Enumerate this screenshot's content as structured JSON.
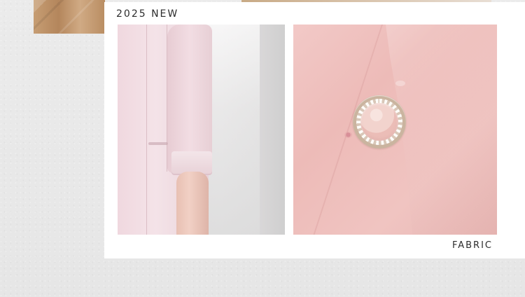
{
  "header": {
    "title": "2025 NEW"
  },
  "panels": {
    "right_label": "FABRIC"
  }
}
